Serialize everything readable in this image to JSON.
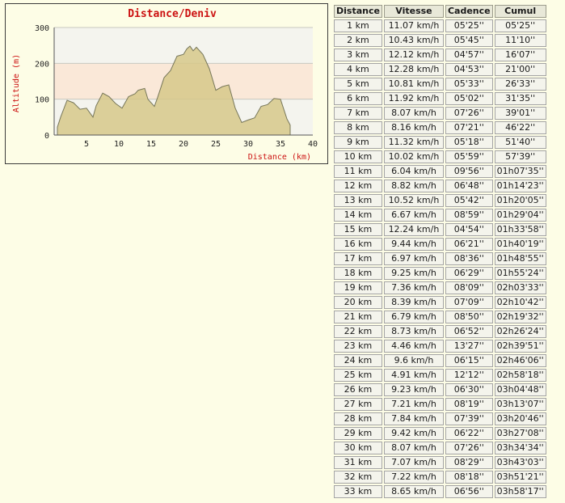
{
  "chart_data": {
    "type": "area",
    "title": "Distance/Deniv",
    "xlabel": "Distance (km)",
    "ylabel": "Altitude (m)",
    "xlim": [
      0,
      40
    ],
    "ylim": [
      0,
      300
    ],
    "x_ticks": [
      5,
      10,
      15,
      20,
      25,
      30,
      35,
      40
    ],
    "y_ticks": [
      0,
      100,
      200,
      300
    ],
    "grid": true,
    "colors": {
      "fill": "#d6c88a",
      "line": "#77775a",
      "title": "#cc1111",
      "axis_label": "#cc1111",
      "band": "#fae8d8"
    },
    "x": [
      0.5,
      1,
      2,
      3,
      4,
      5,
      6,
      6.5,
      7.5,
      8.5,
      9.5,
      10.5,
      11.5,
      12.5,
      13,
      14,
      14.5,
      15.5,
      16,
      17,
      18,
      19,
      20,
      20.5,
      21,
      21.5,
      22,
      23,
      24,
      25,
      26,
      27,
      28,
      29,
      30,
      31,
      32,
      33,
      34,
      35,
      36,
      36.5
    ],
    "y": [
      22,
      50,
      97,
      90,
      72,
      75,
      50,
      82,
      117,
      107,
      88,
      75,
      107,
      115,
      125,
      130,
      100,
      80,
      105,
      160,
      180,
      220,
      225,
      240,
      248,
      235,
      245,
      225,
      185,
      125,
      135,
      140,
      75,
      35,
      42,
      48,
      80,
      85,
      102,
      100,
      45,
      28
    ]
  },
  "table": {
    "headers": [
      "Distance",
      "Vitesse",
      "Cadence",
      "Cumul"
    ],
    "rows": [
      [
        "1 km",
        "11.07 km/h",
        "05'25''",
        "05'25''"
      ],
      [
        "2 km",
        "10.43 km/h",
        "05'45''",
        "11'10''"
      ],
      [
        "3 km",
        "12.12 km/h",
        "04'57''",
        "16'07''"
      ],
      [
        "4 km",
        "12.28 km/h",
        "04'53''",
        "21'00''"
      ],
      [
        "5 km",
        "10.81 km/h",
        "05'33''",
        "26'33''"
      ],
      [
        "6 km",
        "11.92 km/h",
        "05'02''",
        "31'35''"
      ],
      [
        "7 km",
        "8.07 km/h",
        "07'26''",
        "39'01''"
      ],
      [
        "8 km",
        "8.16 km/h",
        "07'21''",
        "46'22''"
      ],
      [
        "9 km",
        "11.32 km/h",
        "05'18''",
        "51'40''"
      ],
      [
        "10 km",
        "10.02 km/h",
        "05'59''",
        "57'39''"
      ],
      [
        "11 km",
        "6.04 km/h",
        "09'56''",
        "01h07'35''"
      ],
      [
        "12 km",
        "8.82 km/h",
        "06'48''",
        "01h14'23''"
      ],
      [
        "13 km",
        "10.52 km/h",
        "05'42''",
        "01h20'05''"
      ],
      [
        "14 km",
        "6.67 km/h",
        "08'59''",
        "01h29'04''"
      ],
      [
        "15 km",
        "12.24 km/h",
        "04'54''",
        "01h33'58''"
      ],
      [
        "16 km",
        "9.44 km/h",
        "06'21''",
        "01h40'19''"
      ],
      [
        "17 km",
        "6.97 km/h",
        "08'36''",
        "01h48'55''"
      ],
      [
        "18 km",
        "9.25 km/h",
        "06'29''",
        "01h55'24''"
      ],
      [
        "19 km",
        "7.36 km/h",
        "08'09''",
        "02h03'33''"
      ],
      [
        "20 km",
        "8.39 km/h",
        "07'09''",
        "02h10'42''"
      ],
      [
        "21 km",
        "6.79 km/h",
        "08'50''",
        "02h19'32''"
      ],
      [
        "22 km",
        "8.73 km/h",
        "06'52''",
        "02h26'24''"
      ],
      [
        "23 km",
        "4.46 km/h",
        "13'27''",
        "02h39'51''"
      ],
      [
        "24 km",
        "9.6 km/h",
        "06'15''",
        "02h46'06''"
      ],
      [
        "25 km",
        "4.91 km/h",
        "12'12''",
        "02h58'18''"
      ],
      [
        "26 km",
        "9.23 km/h",
        "06'30''",
        "03h04'48''"
      ],
      [
        "27 km",
        "7.21 km/h",
        "08'19''",
        "03h13'07''"
      ],
      [
        "28 km",
        "7.84 km/h",
        "07'39''",
        "03h20'46''"
      ],
      [
        "29 km",
        "9.42 km/h",
        "06'22''",
        "03h27'08''"
      ],
      [
        "30 km",
        "8.07 km/h",
        "07'26''",
        "03h34'34''"
      ],
      [
        "31 km",
        "7.07 km/h",
        "08'29''",
        "03h43'03''"
      ],
      [
        "32 km",
        "7.22 km/h",
        "08'18''",
        "03h51'21''"
      ],
      [
        "33 km",
        "8.65 km/h",
        "06'56''",
        "03h58'17''"
      ]
    ]
  }
}
